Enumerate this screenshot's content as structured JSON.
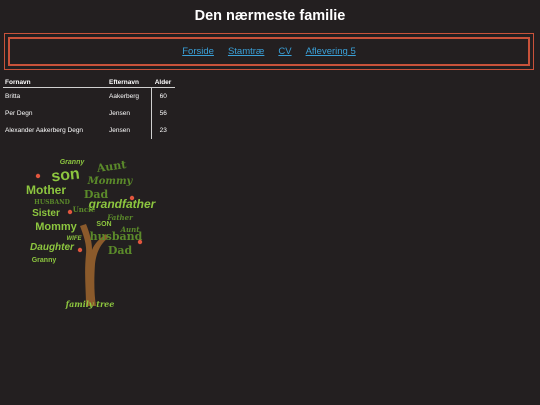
{
  "page": {
    "title": "Den nærmeste familie"
  },
  "nav": {
    "items": [
      {
        "label": "Forside"
      },
      {
        "label": "Stamtræ"
      },
      {
        "label": "CV"
      },
      {
        "label": "Aflevering 5"
      }
    ]
  },
  "table": {
    "headers": [
      "Fornavn",
      "Efternavn",
      "Alder"
    ],
    "rows": [
      {
        "first": "Britta",
        "last": "Aakerberg",
        "age": "60"
      },
      {
        "first": "Per Degn",
        "last": "Jensen",
        "age": "56"
      },
      {
        "first": "Alexander Aakerberg Degn",
        "last": "Jensen",
        "age": "23"
      }
    ]
  },
  "tree_image": {
    "icon": "family-tree-word-cloud-image",
    "words": [
      "Granny",
      "Aunt",
      "son",
      "Mommy",
      "Mother",
      "Dad",
      "grandfather",
      "HUSBAND",
      "Sister",
      "Father",
      "Mommy",
      "husband",
      "Daughter",
      "Dad",
      "Granny",
      "Aunt",
      "SON",
      "Uncle",
      "WIFE"
    ],
    "caption": "family tree",
    "colors": {
      "leaves_light": "#8dc63f",
      "leaves_dark": "#5b8a2a",
      "trunk": "#8b5a2b",
      "heart": "#e2563e"
    }
  }
}
